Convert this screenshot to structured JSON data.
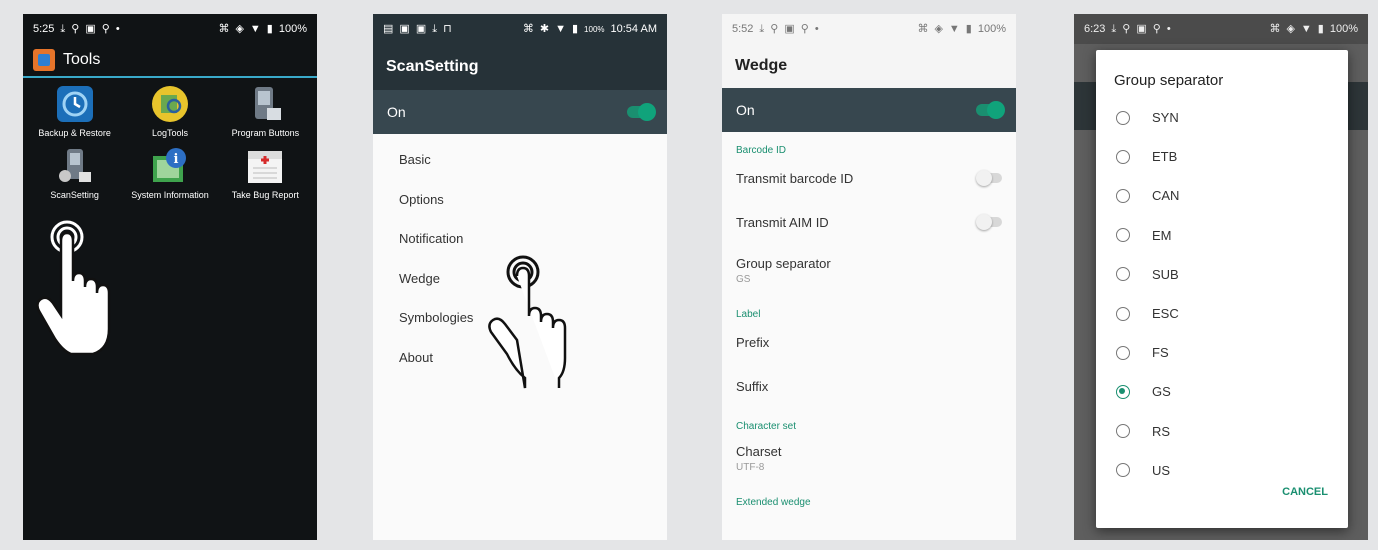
{
  "phone1": {
    "status": {
      "time": "5:25",
      "battery": "100%"
    },
    "title": "Tools",
    "apps": [
      {
        "label": "Backup & Restore",
        "icon": "backup-restore-icon"
      },
      {
        "label": "LogTools",
        "icon": "logtools-icon"
      },
      {
        "label": "Program Buttons",
        "icon": "program-buttons-icon"
      },
      {
        "label": "ScanSetting",
        "icon": "scansetting-icon"
      },
      {
        "label": "System Information",
        "icon": "system-information-icon"
      },
      {
        "label": "Take Bug Report",
        "icon": "bug-report-icon"
      }
    ]
  },
  "phone2": {
    "status": {
      "battery": "100%",
      "time": "10:54 AM"
    },
    "title": "ScanSetting",
    "switch_label": "On",
    "menu": [
      "Basic",
      "Options",
      "Notification",
      "Wedge",
      "Symbologies",
      "About"
    ]
  },
  "phone3": {
    "status": {
      "time": "5:52",
      "battery": "100%"
    },
    "title": "Wedge",
    "switch_label": "On",
    "cat_barcode": "Barcode ID",
    "transmit_barcode_id": "Transmit barcode ID",
    "transmit_aim_id": "Transmit AIM ID",
    "group_separator": "Group separator",
    "group_separator_value": "GS",
    "cat_label": "Label",
    "prefix": "Prefix",
    "suffix": "Suffix",
    "cat_charset": "Character set",
    "charset": "Charset",
    "charset_value": "UTF-8",
    "cat_extended": "Extended wedge"
  },
  "phone4": {
    "status": {
      "time": "6:23",
      "battery": "100%"
    },
    "dialog_title": "Group separator",
    "options": [
      "SYN",
      "ETB",
      "CAN",
      "EM",
      "SUB",
      "ESC",
      "FS",
      "GS",
      "RS",
      "US"
    ],
    "selected": "GS",
    "cancel_label": "CANCEL"
  },
  "colors": {
    "accent": "#1a8f70",
    "toolbar": "#263238",
    "tools_bar": "#39a9c9"
  }
}
